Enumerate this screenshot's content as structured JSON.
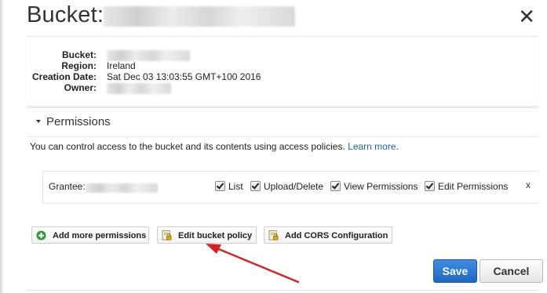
{
  "dialog": {
    "title": "Bucket:",
    "close_glyph": "✕"
  },
  "info": {
    "bucket_label": "Bucket:",
    "region_label": "Region:",
    "region_value": "Ireland",
    "creation_label": "Creation Date:",
    "creation_value": "Sat Dec 03 13:03:55 GMT+100 2016",
    "owner_label": "Owner:"
  },
  "permissions": {
    "title": "Permissions",
    "description": "You can control access to the bucket and its contents using access policies.",
    "learn_more": "Learn more",
    "period": ".",
    "grantee_label": "Grantee:",
    "checkboxes": [
      "List",
      "Upload/Delete",
      "View Permissions",
      "Edit Permissions"
    ],
    "remove_glyph": "x"
  },
  "actions": {
    "add_more": "Add more permissions",
    "edit_policy": "Edit bucket policy",
    "add_cors": "Add CORS Configuration"
  },
  "footer": {
    "save": "Save",
    "cancel": "Cancel"
  },
  "colors": {
    "accent": "#2a74cf",
    "link": "#1a64a8",
    "annotation_arrow": "#d62222"
  },
  "icons": {
    "add": "plus-circle-icon",
    "policy": "document-lock-icon",
    "cors": "document-lock-icon",
    "close": "close-icon",
    "caret": "caret-down-icon"
  }
}
